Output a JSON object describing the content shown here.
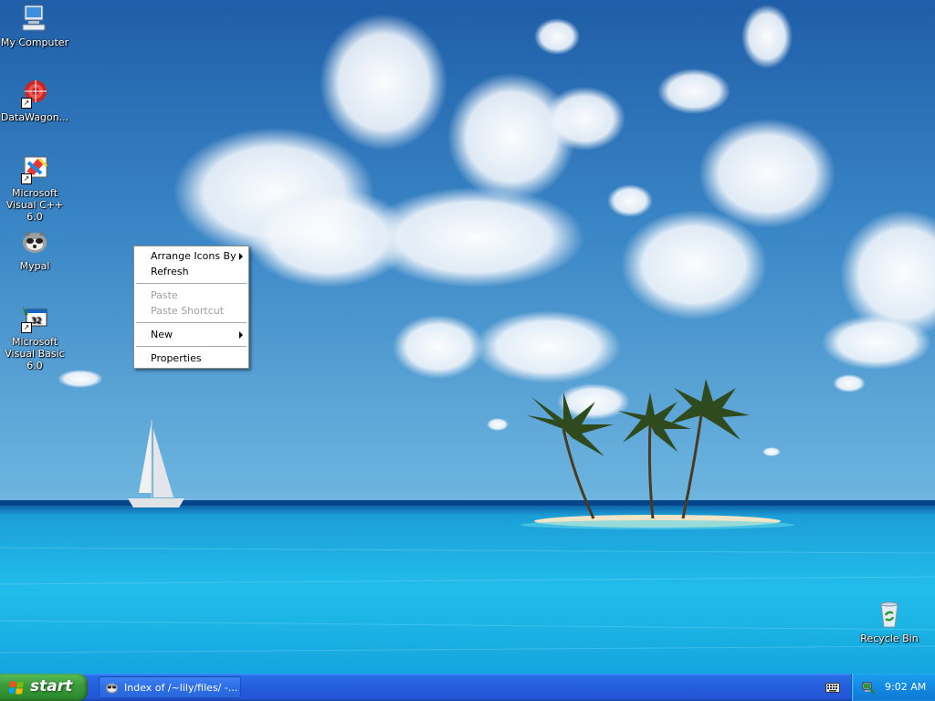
{
  "desktop": {
    "icons": [
      {
        "label": "My Computer",
        "icon": "my-computer-icon"
      },
      {
        "label": "DataWagon...",
        "icon": "datawagon-icon"
      },
      {
        "label": "Microsoft Visual C++ 6.0",
        "icon": "visual-cpp-icon"
      },
      {
        "label": "Mypal",
        "icon": "mypal-icon"
      },
      {
        "label": "Microsoft Visual Basic 6.0",
        "icon": "visual-basic-icon"
      },
      {
        "label": "Recycle Bin",
        "icon": "recycle-bin-icon"
      }
    ]
  },
  "context_menu": {
    "arrange_icons_by": "Arrange Icons By",
    "refresh": "Refresh",
    "paste": "Paste",
    "paste_shortcut": "Paste Shortcut",
    "new": "New",
    "properties": "Properties"
  },
  "taskbar": {
    "start_label": "start",
    "task_button_label": "Index of /~lily/files/ -...",
    "clock": "9:02 AM"
  },
  "colors": {
    "taskbar_blue": "#245edc",
    "start_green": "#3c9b3c",
    "tray_blue": "#1289e3",
    "sky": "#2f7fc0",
    "sea": "#1fb6e6"
  }
}
